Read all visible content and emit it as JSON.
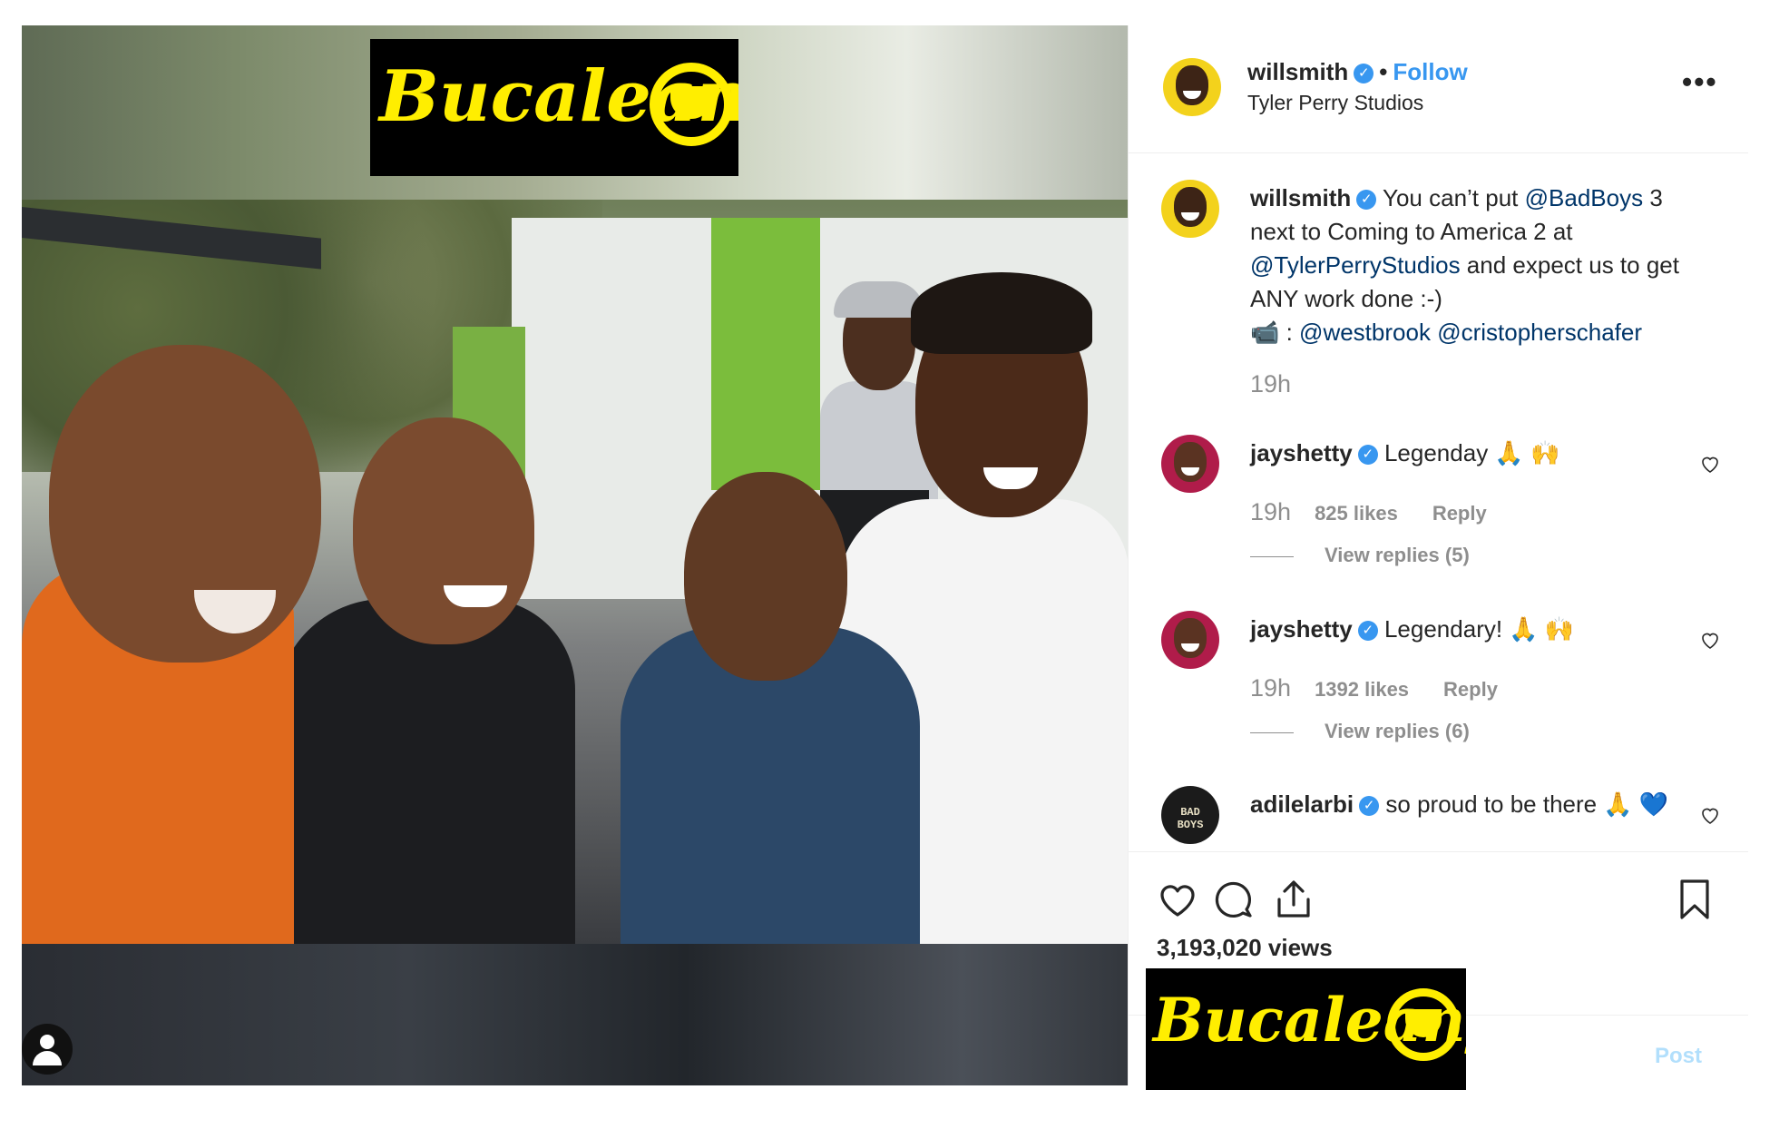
{
  "header": {
    "username": "willsmith",
    "follow_label": "Follow",
    "dot": "•",
    "location": "Tyler Perry Studios",
    "more": "•••"
  },
  "caption": {
    "username": "willsmith",
    "text_1": "You can’t put ",
    "mention_1": "@BadBoys",
    "text_2": " 3 next to Coming to America 2 at ",
    "mention_2": "@TylerPerryStudios",
    "text_3": " and expect us to get ANY work done :-)",
    "camera": "📹",
    "text_4": " : ",
    "mention_3": "@westbrook",
    "text_5": " ",
    "mention_4": "@cristopherschafer",
    "time": "19h"
  },
  "comments": [
    {
      "username": "jayshetty",
      "text": "Legenday 🙏 🙌",
      "time": "19h",
      "likes": "825 likes",
      "reply": "Reply",
      "view_replies": "View replies (5)"
    },
    {
      "username": "jayshetty",
      "text": "Legendary! 🙏 🙌",
      "time": "19h",
      "likes": "1392 likes",
      "reply": "Reply",
      "view_replies": "View replies (6)"
    },
    {
      "username": "adilelarbi",
      "text": "so proud to be there 🙏 💙",
      "avatar_label": "BAD BOYS"
    }
  ],
  "stats": {
    "views": "3,193,020 views"
  },
  "add_comment": {
    "post_label": "Post"
  },
  "watermark": {
    "text": "Bucaleany"
  },
  "colors": {
    "accent": "#3897f0",
    "text": "#262626",
    "muted": "#8e8e8e",
    "mention": "#003569",
    "logo_yellow": "#ffee00"
  },
  "icons": [
    "verified-icon",
    "more-options-icon",
    "heart-icon",
    "comment-icon",
    "share-icon",
    "bookmark-icon",
    "heart-small-icon",
    "user-tag-icon"
  ]
}
